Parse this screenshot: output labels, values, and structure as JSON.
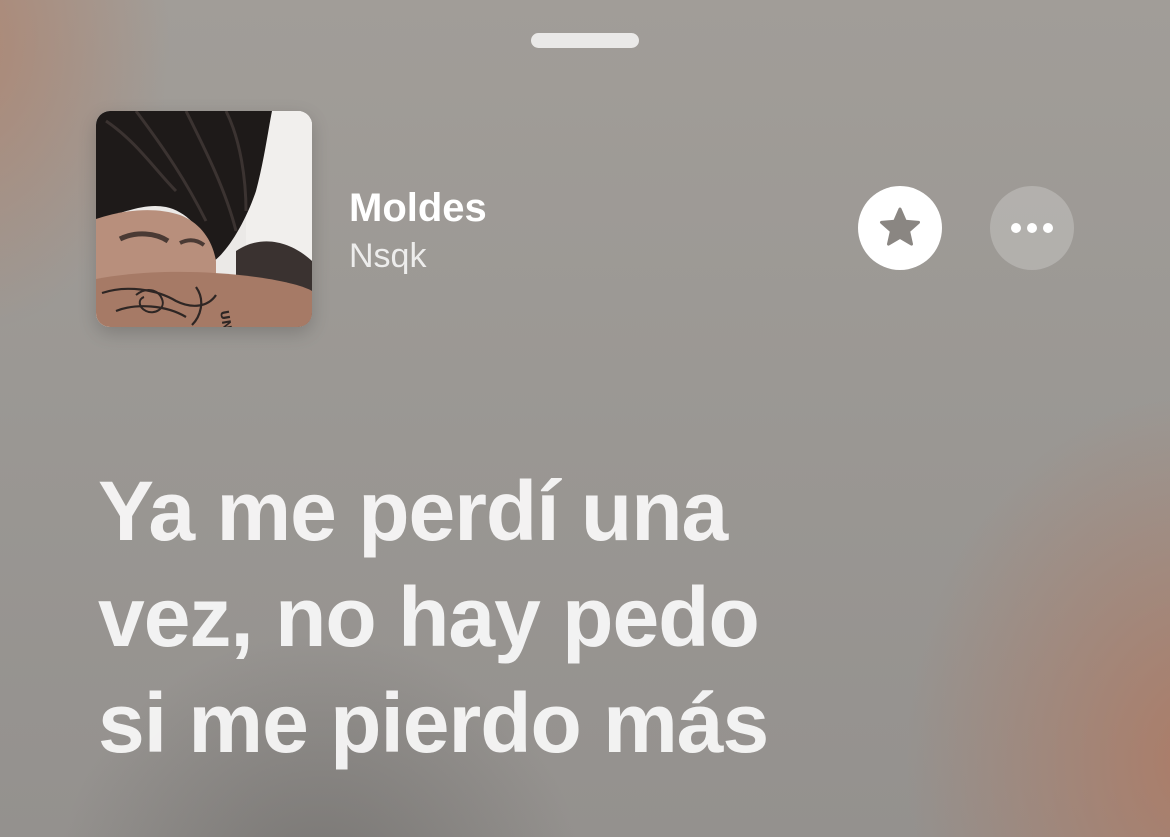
{
  "colors": {
    "background_top": "#a19d98",
    "accent_warm": "#b07860",
    "text_primary": "#ffffff",
    "star_icon_color": "#8a8682"
  },
  "now_playing": {
    "title": "Moldes",
    "artist": "Nsqk",
    "artwork": "album-artwork"
  },
  "actions": {
    "favorite_icon": "star-icon",
    "more_icon": "ellipsis-icon"
  },
  "lyrics": {
    "lines": [
      "Ya me perdí una",
      "vez, no hay pedo",
      "si me pierdo más"
    ]
  }
}
